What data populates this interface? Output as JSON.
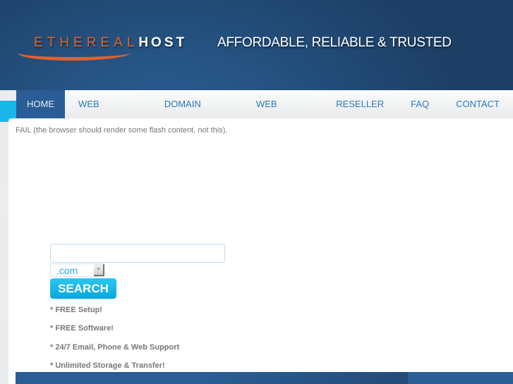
{
  "brand": {
    "logo_part1": "ETHEREAL",
    "logo_part2": "HOST",
    "tagline": "AFFORDABLE, RELIABLE & TRUSTED"
  },
  "nav": {
    "items": [
      {
        "label": "HOME",
        "active": true
      },
      {
        "label": "WEB HOSTING"
      },
      {
        "label": "DOMAIN NAMES"
      },
      {
        "label": "WEB DESIGN"
      },
      {
        "label": "RESELLER"
      },
      {
        "label": "FAQ"
      },
      {
        "label": "CONTACT"
      }
    ]
  },
  "main": {
    "flash_fallback": "FAIL (the browser should render some flash content, not this).",
    "domain_search": {
      "value": "",
      "placeholder": "",
      "tld_selected": ".com",
      "button": "SEARCH"
    },
    "features": [
      "* FREE Setup!",
      "* FREE Software!",
      "* 24/7 Email, Phone & Web Support",
      "* Unlimited Storage & Transfer!"
    ]
  },
  "colors": {
    "header": "#24517f",
    "nav_active": "#2a5d95",
    "nav_text": "#2b79b8",
    "accent_orange": "#e0622f",
    "search_button": "#19b6ea"
  }
}
